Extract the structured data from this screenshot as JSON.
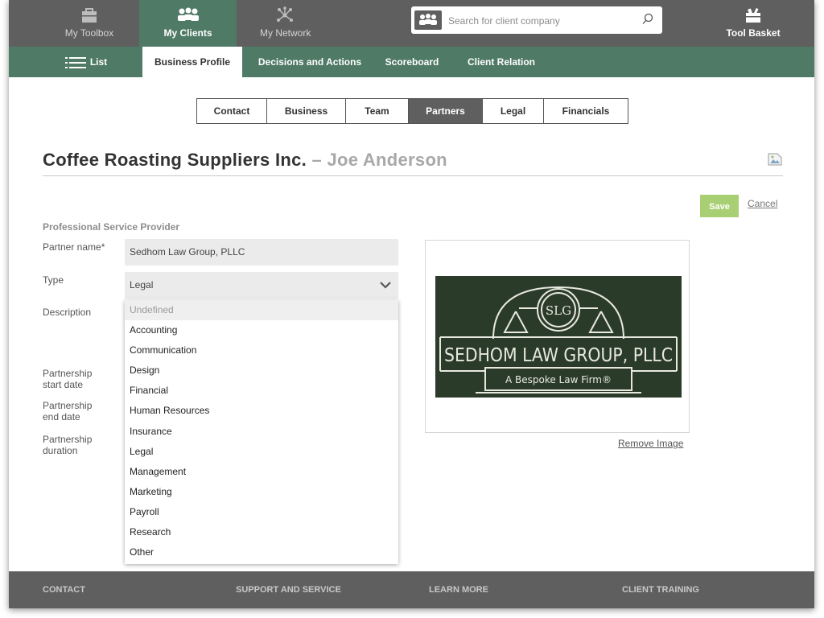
{
  "topnav": {
    "items": [
      {
        "label": "My Toolbox",
        "icon": "toolbox-icon"
      },
      {
        "label": "My Clients",
        "icon": "clients-icon"
      },
      {
        "label": "My Network",
        "icon": "network-icon"
      }
    ],
    "search_placeholder": "Search for client company",
    "tool_basket": "Tool Basket"
  },
  "subnav": {
    "list_label": "List",
    "items": [
      "Business Profile",
      "Decisions and Actions",
      "Scoreboard",
      "Client Relation"
    ]
  },
  "tabs": [
    "Contact",
    "Business",
    "Team",
    "Partners",
    "Legal",
    "Financials"
  ],
  "title": {
    "company": "Coffee Roasting Suppliers Inc.",
    "dash": "–",
    "person": "Joe Anderson"
  },
  "actions": {
    "save": "Save",
    "cancel": "Cancel"
  },
  "form": {
    "section": "Professional Service Provider",
    "partner_name_label": "Partner name*",
    "partner_name_value": "Sedhom Law Group, PLLC",
    "type_label": "Type",
    "type_value": "Legal",
    "description_label": "Description",
    "start_label": [
      "Partnership",
      "start date"
    ],
    "end_label": [
      "Partnership",
      "end date"
    ],
    "duration_label": [
      "Partnership",
      "duration"
    ]
  },
  "type_options": [
    "Undefined",
    "Accounting",
    "Communication",
    "Design",
    "Financial",
    "Human Resources",
    "Insurance",
    "Legal",
    "Management",
    "Marketing",
    "Payroll",
    "Research",
    "Other"
  ],
  "logo": {
    "name": "SEDHOM LAW GROUP, PLLC",
    "tagline": "A Bespoke Law Firm®",
    "monogram": "SLG",
    "bg_color": "#2b3b2a"
  },
  "remove_image": "Remove Image",
  "footer": [
    "CONTACT",
    "SUPPORT AND SERVICE",
    "LEARN MORE",
    "CLIENT TRAINING"
  ],
  "colors": {
    "nav": "#5f5f5f",
    "accent_green": "#4f7a66",
    "save_green": "#a9cf74"
  }
}
